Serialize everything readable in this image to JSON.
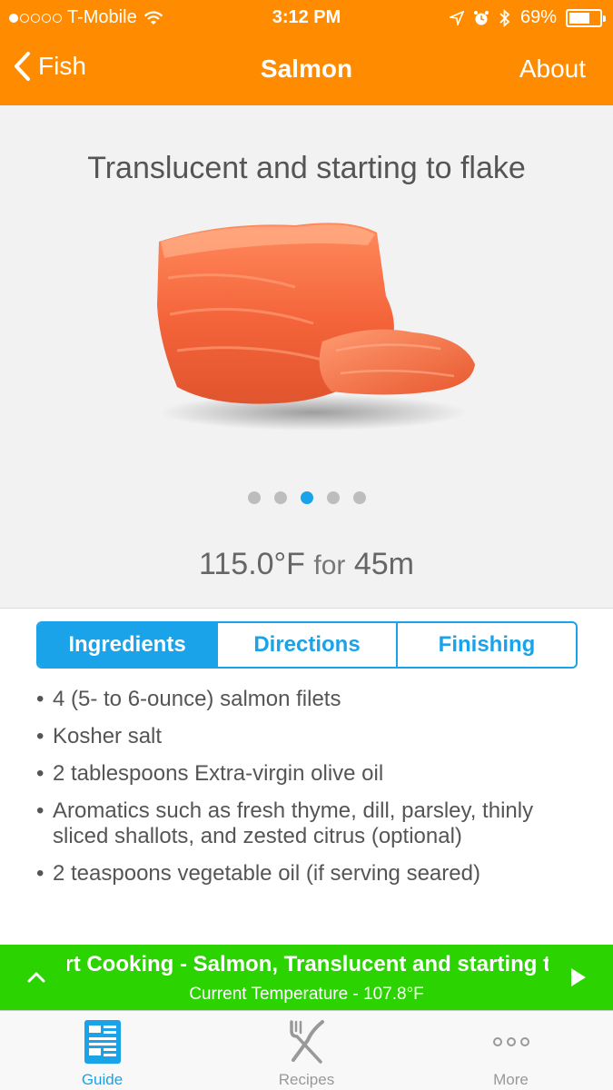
{
  "status": {
    "carrier": "T-Mobile",
    "time": "3:12 PM",
    "battery": "69%",
    "battery_level": 0.69,
    "signal_bars_filled": 1
  },
  "nav": {
    "back_label": "Fish",
    "title": "Salmon",
    "about_label": "About"
  },
  "guide": {
    "caption": "Translucent and starting to flake",
    "page_count": 5,
    "current_page": 3,
    "temperature": "115.0°F",
    "for_word": "for",
    "duration": "45m"
  },
  "tabs": [
    {
      "label": "Ingredients",
      "active": true
    },
    {
      "label": "Directions",
      "active": false
    },
    {
      "label": "Finishing",
      "active": false
    }
  ],
  "ingredients": [
    "4 (5- to 6-ounce) salmon filets",
    "Kosher salt",
    "2 tablespoons Extra-virgin olive oil",
    "Aromatics such as fresh thyme, dill, parsley, thinly sliced shallots, and zested citrus (optional)",
    "2 teaspoons vegetable oil (if serving seared)"
  ],
  "banner": {
    "title": "Start Cooking - Salmon, Translucent and starting to flake",
    "subtitle": "Current Temperature - 107.8°F"
  },
  "tabbar": [
    {
      "label": "Guide",
      "icon": "guide-icon",
      "active": true
    },
    {
      "label": "Recipes",
      "icon": "fork-knife-icon",
      "active": false
    },
    {
      "label": "More",
      "icon": "more-dots-icon",
      "active": false
    }
  ],
  "colors": {
    "header": "#ff8c00",
    "accent": "#1aa3e8",
    "banner": "#2bd300"
  }
}
